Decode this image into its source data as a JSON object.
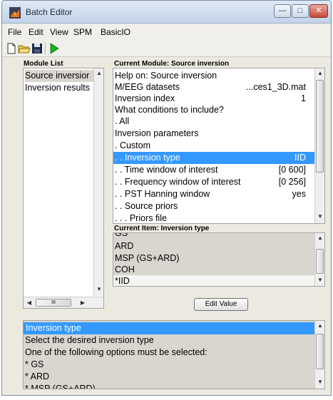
{
  "window": {
    "title": "Batch Editor",
    "controls": [
      "—",
      "□",
      "✕"
    ]
  },
  "menu": [
    "File",
    "Edit",
    "View",
    "SPM",
    "BasicIO"
  ],
  "module_list": {
    "header": "Module List",
    "items": [
      "Source inversior",
      "Inversion results"
    ]
  },
  "current_module": {
    "header": "Current Module: Source inversion",
    "rows": [
      {
        "label": "Help on: Source inversion",
        "value": ""
      },
      {
        "label": "M/EEG datasets",
        "value": "...ces1_3D.mat"
      },
      {
        "label": "Inversion index",
        "value": "1"
      },
      {
        "label": "What conditions to include?",
        "value": ""
      },
      {
        "label": ". All",
        "value": ""
      },
      {
        "label": "Inversion parameters",
        "value": ""
      },
      {
        "label": ". Custom",
        "value": ""
      },
      {
        "label": ". . Inversion type",
        "value": "IID"
      },
      {
        "label": ". . Time window of interest",
        "value": "[0 600]"
      },
      {
        "label": ". . Frequency window of interest",
        "value": "[0 256]"
      },
      {
        "label": ". . PST Hanning window",
        "value": "yes"
      },
      {
        "label": ". . Source priors",
        "value": ""
      },
      {
        "label": ". . . Priors file",
        "value": ""
      }
    ]
  },
  "current_item": {
    "header": "Current Item: Inversion type",
    "options": [
      "GS",
      "ARD",
      "MSP (GS+ARD)",
      "COH",
      "*IID"
    ]
  },
  "edit_value_button": "Edit Value",
  "help": {
    "lines": [
      "Inversion type",
      "Select the desired inversion type",
      "One of the following options must be selected:",
      "* GS",
      "* ARD",
      "* MSP (GS+ARD)"
    ]
  },
  "colors": {
    "selection": "#3399ff",
    "window_bg": "#ece9e0",
    "close_hover": "#c94a3a"
  }
}
